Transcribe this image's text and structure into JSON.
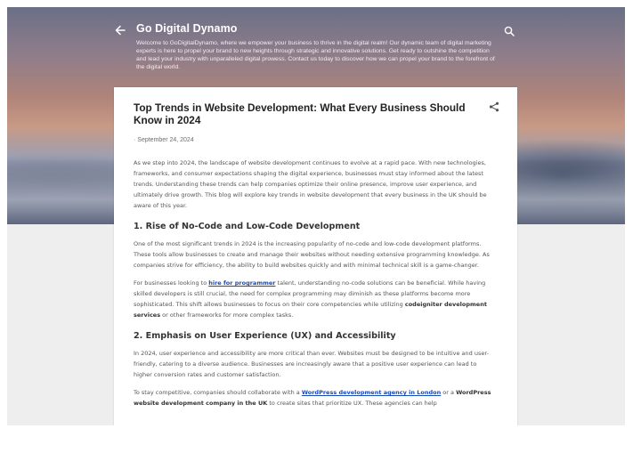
{
  "header": {
    "blog_title": "Go Digital Dynamo",
    "description": "Welcome to GoDigitalDynamo, where we empower your business to thrive in the digital realm! Our dynamic team of digital marketing experts is here to propel your brand to new heights through strategic and innovative solutions. Get ready to outshine the competition and lead your industry with unparalleled digital prowess. Contact us today to discover how we can propel your brand to the forefront of the digital world.",
    "back_icon": "arrow-left-icon",
    "search_icon": "search-icon"
  },
  "post": {
    "title": "Top Trends in Website Development: What Every Business Should Know in 2024",
    "date": "September 24, 2024",
    "share_icon": "share-icon",
    "intro": "As we step into 2024, the landscape of website development continues to evolve at a rapid pace. With new technologies, frameworks, and consumer expectations shaping the digital experience, businesses must stay informed about the latest trends. Understanding these trends can help companies optimize their online presence, improve user experience, and ultimately drive growth. This blog will explore key trends in website development that every business in the UK should be aware of this year.",
    "section1": {
      "heading": "1. Rise of No-Code and Low-Code Development",
      "p1": "One of the most significant trends in 2024 is the increasing popularity of no-code and low-code development platforms. These tools allow businesses to create and manage their websites without needing extensive programming knowledge. As companies strive for efficiency, the ability to build websites quickly and with minimal technical skill is a game-changer.",
      "p2_before_link": "For businesses looking to ",
      "p2_link": "hire for programmer",
      "p2_after_link": " talent, understanding no-code solutions can be beneficial. While having skilled developers is still crucial, the need for complex programming may diminish as these platforms become more sophisticated. This shift allows businesses to focus on their core competencies while utilizing ",
      "p2_bold": "codeigniter development services",
      "p2_end": " or other frameworks for more complex tasks."
    },
    "section2": {
      "heading": "2. Emphasis on User Experience (UX) and Accessibility",
      "p1": "In 2024, user experience and accessibility are more critical than ever. Websites must be designed to be intuitive and user-friendly, catering to a diverse audience. Businesses are increasingly aware that a positive user experience can lead to higher conversion rates and customer satisfaction.",
      "p2_before_link": "To stay competitive, companies should collaborate with a ",
      "p2_link": "WordPress development agency in London",
      "p2_mid": " or a ",
      "p2_bold": "WordPress website development company in the UK",
      "p2_end": " to create sites that prioritize UX. These agencies can help"
    }
  }
}
